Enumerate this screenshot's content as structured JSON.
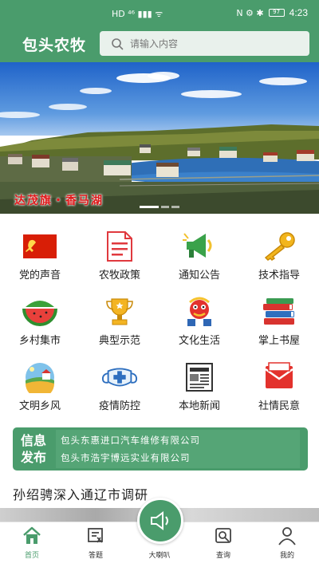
{
  "status_bar": {
    "left_indicators": "HD ⁴⁶ ▮▮▮ ᯤ",
    "right_indicators": "N ⚙ ✱",
    "battery": "97",
    "time": "4:23"
  },
  "header": {
    "app_title": "包头农牧",
    "search_placeholder": "请输入内容"
  },
  "banner": {
    "caption": "达茂旗・香马湖",
    "active_slide": 1,
    "slide_count": 3
  },
  "grid_items": [
    {
      "label": "党的声音",
      "icon": "party-flag-icon"
    },
    {
      "label": "农牧政策",
      "icon": "policy-document-icon"
    },
    {
      "label": "通知公告",
      "icon": "megaphone-icon"
    },
    {
      "label": "技术指导",
      "icon": "key-icon"
    },
    {
      "label": "乡村集市",
      "icon": "watermelon-icon"
    },
    {
      "label": "典型示范",
      "icon": "trophy-icon"
    },
    {
      "label": "文化生活",
      "icon": "culture-lion-icon"
    },
    {
      "label": "掌上书屋",
      "icon": "books-icon"
    },
    {
      "label": "文明乡风",
      "icon": "countryside-icon"
    },
    {
      "label": "疫情防控",
      "icon": "mask-icon"
    },
    {
      "label": "本地新闻",
      "icon": "newspaper-icon"
    },
    {
      "label": "社情民意",
      "icon": "envelope-icon"
    }
  ],
  "info_board": {
    "tag_line1": "信息",
    "tag_line2": "发布",
    "items": [
      "包头东惠进口汽车维修有限公司",
      "包头市浩宇博远实业有限公司"
    ]
  },
  "news": {
    "headline": "孙绍骋深入通辽市调研"
  },
  "bottom_nav": {
    "items": [
      {
        "label": "首页",
        "icon": "home-icon",
        "active": true
      },
      {
        "label": "答题",
        "icon": "quiz-icon",
        "active": false
      },
      {
        "label": "大喇叭",
        "icon": "speaker-icon",
        "active": false
      },
      {
        "label": "查询",
        "icon": "query-icon",
        "active": false
      },
      {
        "label": "我的",
        "icon": "profile-icon",
        "active": false
      }
    ]
  },
  "colors": {
    "primary_green": "#4a9c6c",
    "search_bg": "#e9f1ec",
    "caption_red": "#e0191b"
  }
}
